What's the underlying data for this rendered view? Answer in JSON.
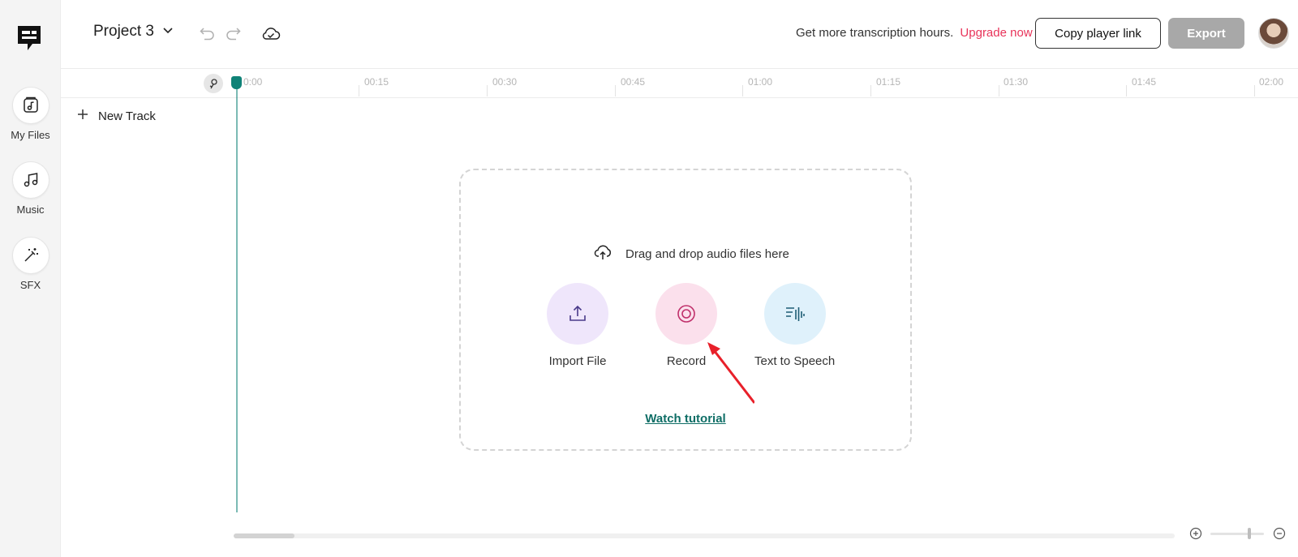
{
  "app": {
    "logo_icon": "chat-bubble-logo-icon"
  },
  "sidebar": {
    "items": [
      {
        "label": "My Files",
        "icon": "music-file-icon"
      },
      {
        "label": "Music",
        "icon": "music-note-icon"
      },
      {
        "label": "SFX",
        "icon": "magic-wand-icon"
      }
    ]
  },
  "header": {
    "project_name": "Project 3",
    "promo_text": "Get more transcription hours.",
    "promo_link": "Upgrade now",
    "copy_link_label": "Copy player link",
    "export_label": "Export",
    "colors": {
      "accent": "#0f8277",
      "promo_link": "#e8345a",
      "export_disabled": "#a8a8a8"
    }
  },
  "timeline": {
    "ticks": [
      "0:00",
      "00:15",
      "00:30",
      "00:45",
      "01:00",
      "01:15",
      "01:30",
      "01:45",
      "02:00"
    ],
    "new_track_label": "New Track"
  },
  "dropzone": {
    "drag_text": "Drag and drop audio files here",
    "actions": [
      {
        "label": "Import File",
        "icon": "upload-icon",
        "color": "#efe6fb"
      },
      {
        "label": "Record",
        "icon": "record-icon",
        "color": "#fbe0ec"
      },
      {
        "label": "Text to Speech",
        "icon": "text-to-speech-icon",
        "color": "#dff1fb"
      }
    ],
    "tutorial_link": "Watch tutorial"
  }
}
